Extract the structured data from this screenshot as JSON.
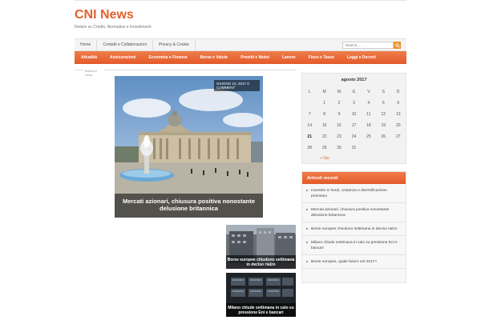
{
  "header": {
    "site_title": "CNI News",
    "site_description": "Notizie su Crediti, Normative e Investimenti"
  },
  "menu": {
    "items": [
      "Home",
      "Contatti e Collaborazioni",
      "Privacy & Cookie"
    ],
    "search_placeholder": "Search...."
  },
  "categories": [
    "Attualità",
    "Assicurazioni",
    "Economia e Finanza",
    "Borse e Valute",
    "Prestiti e Mutui",
    "Lavoro",
    "Fisco e Tasse",
    "Leggi e Decreti"
  ],
  "featured": {
    "label": "featured news",
    "hero": {
      "date": "GIUGNO 10, 2017 0 COMMENT",
      "title": "Mercati azionari, chiusura positiva nonostante delusione britannica"
    },
    "thumbs": [
      {
        "title": "Borse europee chiudono settimana in deciso rialzo"
      },
      {
        "title": "Milano chiude settimana in calo su pressione Eni e bancari"
      }
    ]
  },
  "calendar": {
    "title": "agosto 2017",
    "weekdays": [
      "L",
      "M",
      "M",
      "G",
      "V",
      "S",
      "D"
    ],
    "weeks": [
      [
        "",
        "1",
        "2",
        "3",
        "4",
        "5",
        "6"
      ],
      [
        "7",
        "8",
        "9",
        "10",
        "11",
        "12",
        "13"
      ],
      [
        "14",
        "15",
        "16",
        "17",
        "18",
        "19",
        "20"
      ],
      [
        "21",
        "22",
        "23",
        "24",
        "25",
        "26",
        "27"
      ],
      [
        "28",
        "29",
        "30",
        "31",
        "",
        "",
        ""
      ]
    ],
    "today": "21",
    "prev_link": "« Giu"
  },
  "recent_posts": {
    "title": "Articoli recenti",
    "items": [
      "Investire in fondi, costanza e diversificazione premiano",
      "Mercati azionari, chiusura positiva nonostante delusione britannica",
      "Borse europee chiudono settimana in deciso rialzo",
      "Milano chiude settimana in calo su pressione Eni e bancari",
      "Borse europee, quale futuro nel 2017?"
    ]
  },
  "colors": {
    "accent": "#e2602e",
    "nav_gradient_top": "#f07d4a",
    "nav_gradient_bottom": "#e35a2a"
  }
}
